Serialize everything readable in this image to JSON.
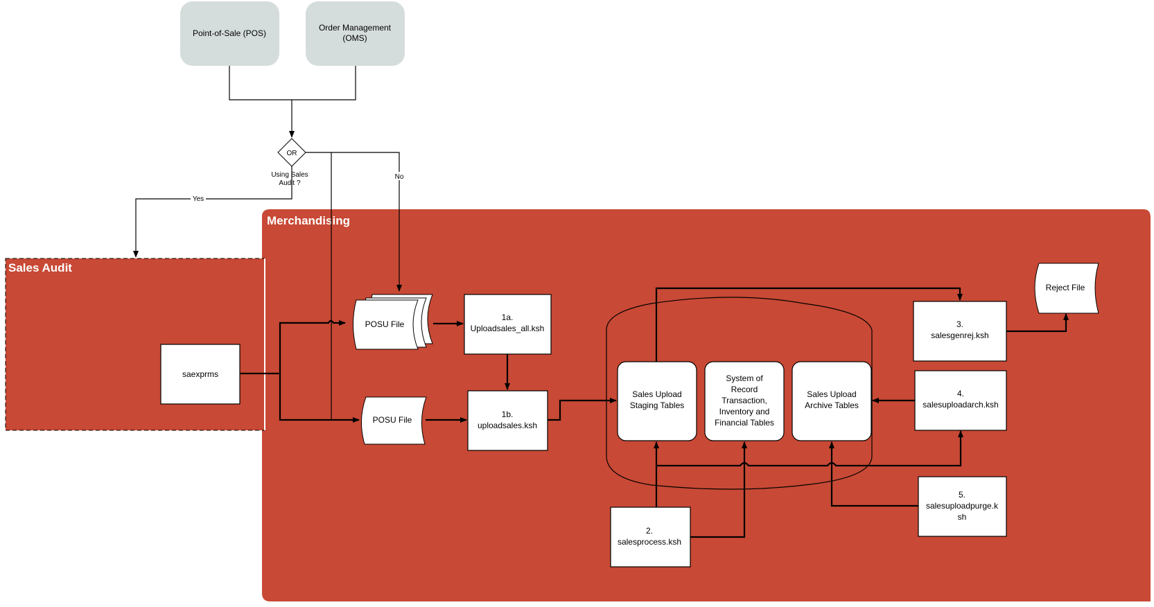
{
  "colors": {
    "swimlane": "#c84935",
    "source_box": "#d5dcdc",
    "node": "#ffffff",
    "line": "#000000"
  },
  "sources": {
    "pos": "Point-of-Sale (POS)",
    "oms_line1": "Order Management",
    "oms_line2": "(OMS)"
  },
  "decision": {
    "label": "OR",
    "question_line1": "Using Sales",
    "question_line2": "Audit ?",
    "yes": "Yes",
    "no": "No"
  },
  "swimlanes": {
    "sales_audit": "Sales Audit",
    "merchandising": "Merchandising"
  },
  "nodes": {
    "saexprms": "saexprms",
    "posu_file_multi": "POSU File",
    "posu_file_single": "POSU File",
    "step_1a_num": "1a.",
    "step_1a_name": "Uploadsales_all.ksh",
    "step_1b_num": "1b.",
    "step_1b_name": "uploadsales.ksh",
    "staging_line1": "Sales Upload",
    "staging_line2": "Staging Tables",
    "sor_line1": "System of",
    "sor_line2": "Record",
    "sor_line3": "Transaction,",
    "sor_line4": "Inventory and",
    "sor_line5": "Financial Tables",
    "archive_line1": "Sales Upload",
    "archive_line2": "Archive Tables",
    "step_2_num": "2.",
    "step_2_name": "salesprocess.ksh",
    "step_3_num": "3.",
    "step_3_name": "salesgenrej.ksh",
    "step_4_num": "4.",
    "step_4_name": "salesuploadarch.ksh",
    "step_5_num": "5.",
    "step_5_name_line1": "salesuploadpurge.k",
    "step_5_name_line2": "sh",
    "reject_file": "Reject File"
  }
}
